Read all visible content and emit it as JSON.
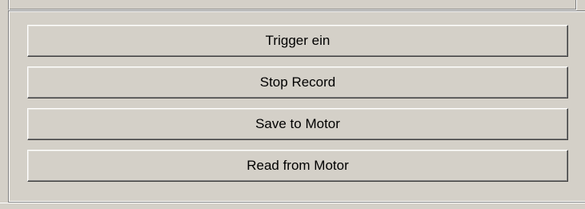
{
  "buttons": {
    "trigger_label": "Trigger ein",
    "stop_record_label": "Stop Record",
    "save_label": "Save to Motor",
    "read_label": "Read from Motor"
  },
  "colors": {
    "face": "#d4d0c8",
    "highlight": "#ffffff",
    "shadow": "#808080",
    "dark_shadow": "#404040"
  }
}
